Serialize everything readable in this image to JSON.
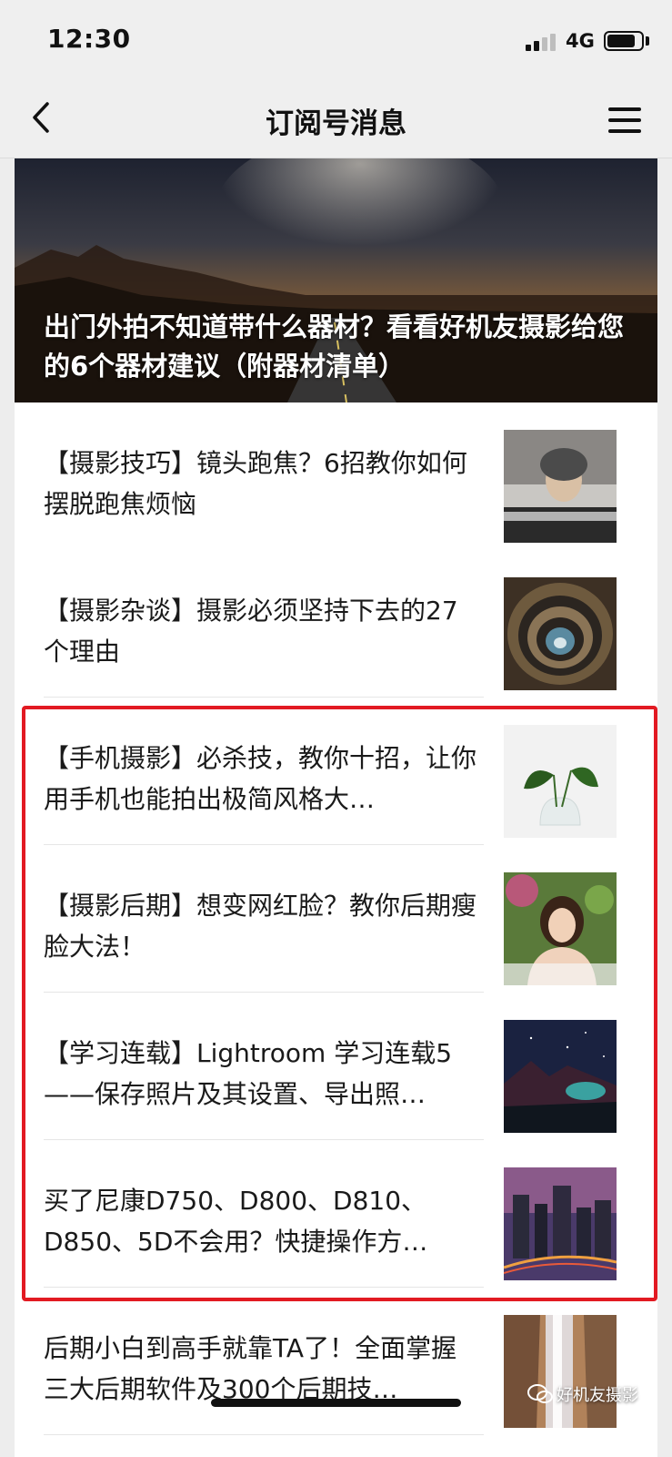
{
  "status_bar": {
    "time": "12:30",
    "network": "4G",
    "battery_level": 0.82
  },
  "nav": {
    "title": "订阅号消息",
    "back_icon": "chevron-left-icon",
    "menu_icon": "hamburger-menu-icon"
  },
  "cover": {
    "title": "出门外拍不知道带什么器材？看看好机友摄影给您的6个器材建议（附器材清单）"
  },
  "articles": [
    {
      "title": "【摄影技巧】镜头跑焦？6招教你如何摆脱跑焦烦恼"
    },
    {
      "title": "【摄影杂谈】摄影必须坚持下去的27个理由"
    },
    {
      "title": "【手机摄影】必杀技，教你十招，让你用手机也能拍出极简风格大…"
    },
    {
      "title": "【摄影后期】想变网红脸？教你后期瘦脸大法！"
    },
    {
      "title": "【学习连载】Lightroom 学习连载5——保存照片及其设置、导出照…"
    },
    {
      "title": "买了尼康D750、D800、D810、D850、5D不会用？快捷操作方…"
    },
    {
      "title": "后期小白到高手就靠TA了！全面掌握三大后期软件及300个后期技…"
    }
  ],
  "watermark": {
    "text": "好机友摄影"
  },
  "colors": {
    "highlight_border": "#e21a22",
    "nav_background": "#efefef"
  }
}
